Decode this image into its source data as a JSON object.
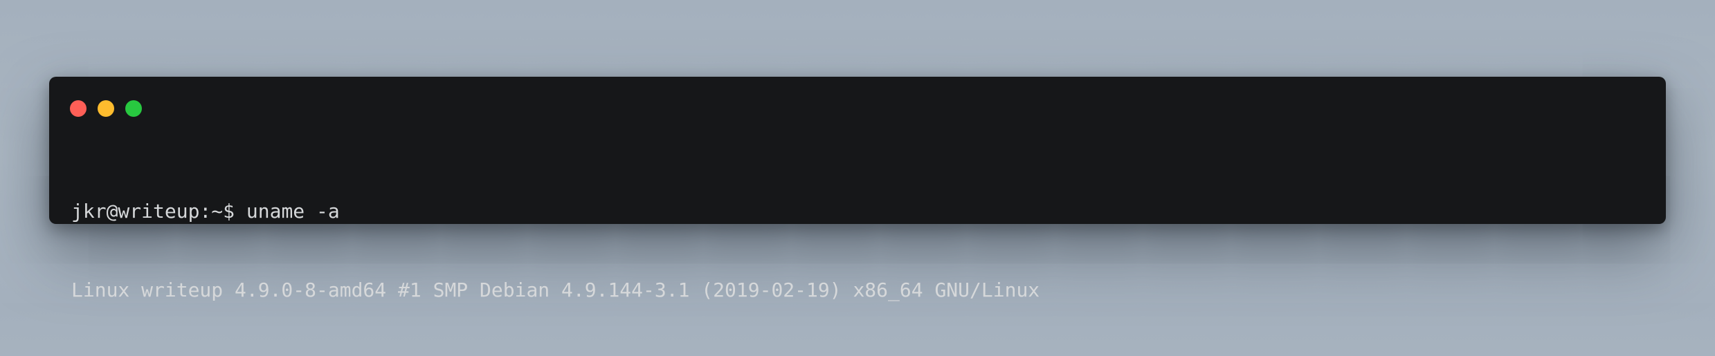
{
  "window": {
    "controls": {
      "close_color": "#ff5f57",
      "minimize_color": "#febc2e",
      "maximize_color": "#28c840"
    },
    "background": "#161719"
  },
  "terminal": {
    "lines": [
      {
        "prompt": "jkr@writeup:~$",
        "command": " uname -a"
      },
      {
        "output": "Linux writeup 4.9.0-8-amd64 #1 SMP Debian 4.9.144-3.1 (2019-02-19) x86_64 GNU/Linux"
      }
    ]
  }
}
